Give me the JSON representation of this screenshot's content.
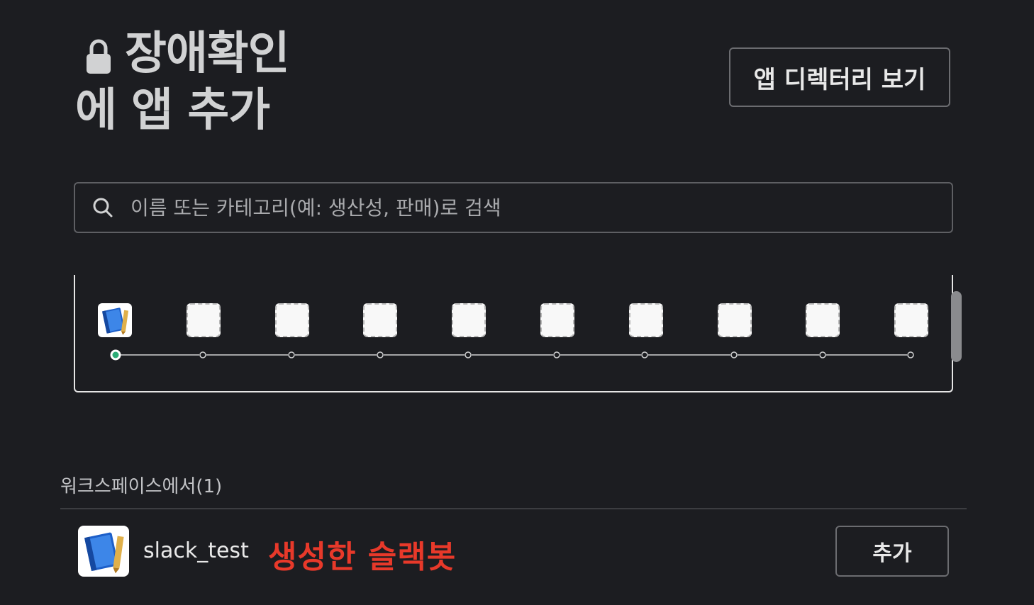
{
  "header": {
    "title_line1": "장애확인",
    "title_line2": "에 앱 추가",
    "directory_button": "앱 디렉터리 보기"
  },
  "search": {
    "placeholder": "이름 또는 카테고리(예: 생산성, 판매)로 검색"
  },
  "workspace_section": {
    "label": "워크스페이스에서(1)",
    "apps": [
      {
        "name": "slack_test",
        "annotation": "생성한 슬랙봇",
        "add_label": "추가"
      }
    ]
  },
  "colors": {
    "background": "#1c1d21",
    "annotation_red": "#e8392a",
    "active_dot": "#2bac76"
  },
  "icons": [
    "lock-icon",
    "search-icon",
    "notebook-app-icon"
  ]
}
